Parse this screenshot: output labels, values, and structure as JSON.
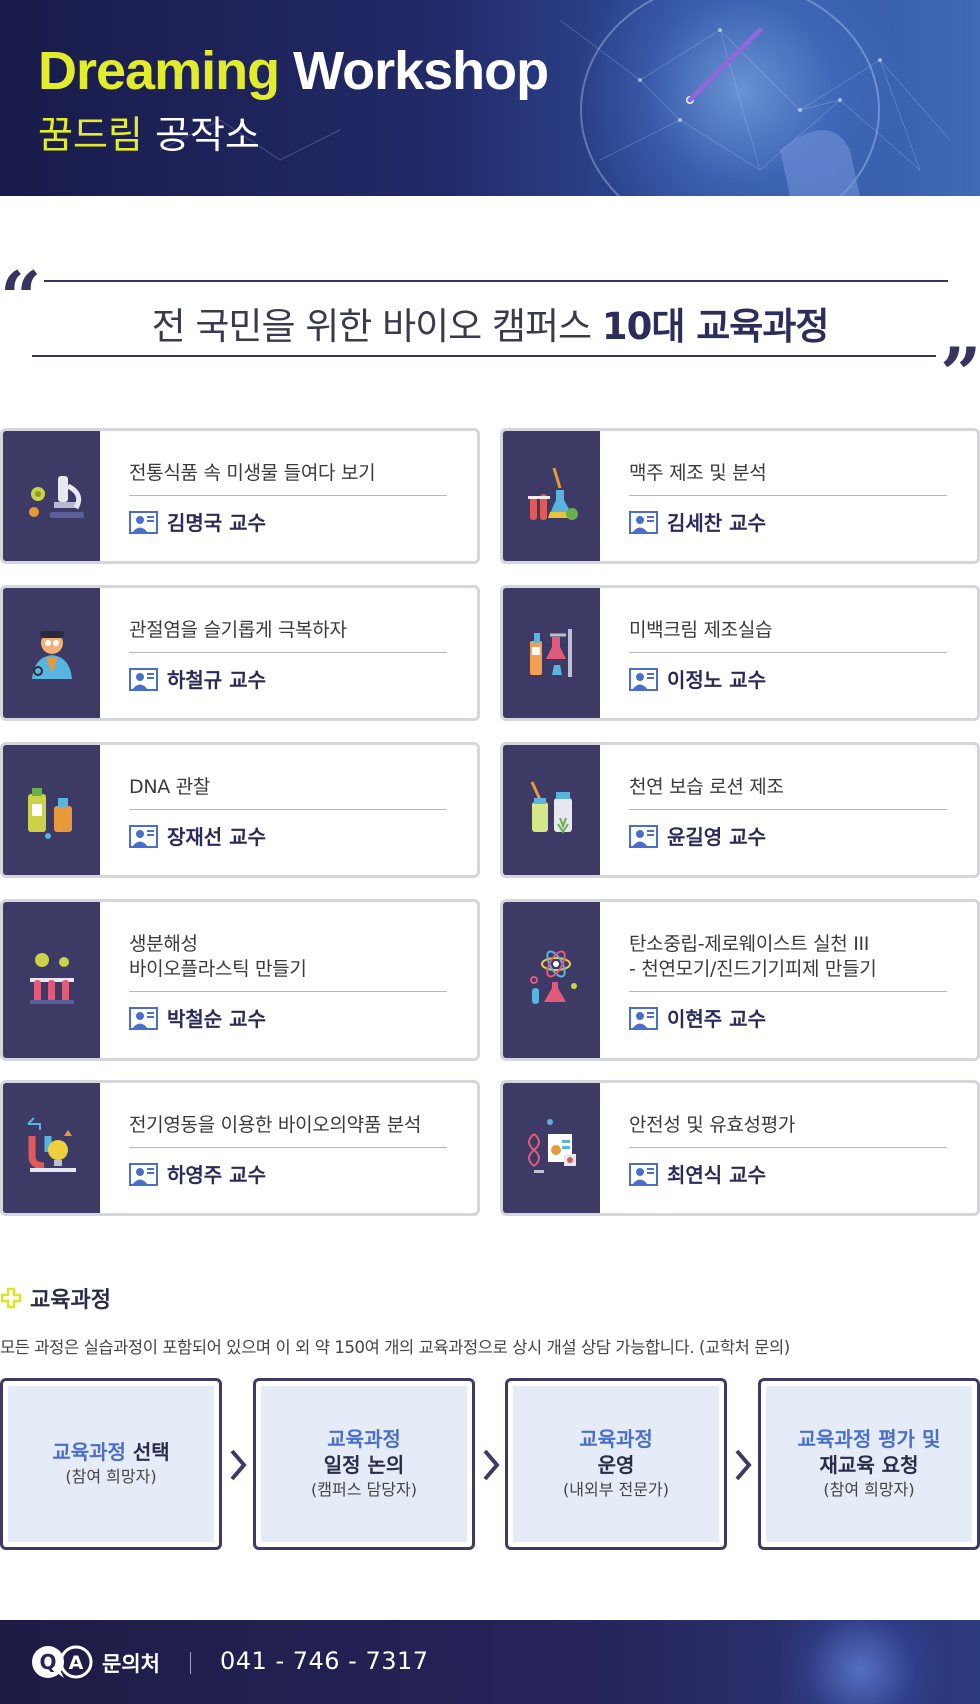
{
  "header": {
    "title_part1": "Dreaming",
    "title_part2": "Workshop",
    "subtitle_part1": "꿈드림",
    "subtitle_part2": "공작소"
  },
  "quote": {
    "text_normal": "전 국민을 위한 바이오 캠퍼스",
    "text_bold": "10대 교육과정"
  },
  "courses": [
    {
      "title": "전통식품 속 미생물 들여다 보기",
      "professor": "김명국 교수",
      "icon": "microscope-icon"
    },
    {
      "title": "맥주 제조 및 분석",
      "professor": "김세찬 교수",
      "icon": "lab-flasks-icon"
    },
    {
      "title": "관절염을 슬기롭게 극복하자",
      "professor": "하철규 교수",
      "icon": "doctor-icon"
    },
    {
      "title": "미백크림 제조실습",
      "professor": "이정노 교수",
      "icon": "lab-stand-icon"
    },
    {
      "title": "DNA 관찰",
      "professor": "장재선 교수",
      "icon": "bottles-icon"
    },
    {
      "title": "천연 보습 로션 제조",
      "professor": "윤길영 교수",
      "icon": "lotion-icon"
    },
    {
      "title": "생분해성\n바이오플라스틱 만들기",
      "professor": "박철순 교수",
      "icon": "test-tubes-icon"
    },
    {
      "title": "탄소중립-제로웨이스트 실천 III\n- 천연모기/진드기기피제 만들기",
      "professor": "이현주 교수",
      "icon": "atom-flask-icon"
    },
    {
      "title": "전기영동을 이용한 바이오의약품 분석",
      "professor": "하영주 교수",
      "icon": "magnet-bulb-icon"
    },
    {
      "title": "안전성 및 유효성평가",
      "professor": "최연식 교수",
      "icon": "dna-report-icon"
    }
  ],
  "curriculum": {
    "heading": "교육과정",
    "description": "모든 과정은 실습과정이 포함되어 있으며 이 외 약 150여 개의 교육과정으로 상시 개설 상담 가능합니다. (교학처 문의)",
    "steps": [
      {
        "line1": "",
        "line2_blue": "교육과정",
        "line2_dark": " 선택",
        "line3": "(참여 희망자)"
      },
      {
        "line1": "교육과정",
        "line2_blue": "",
        "line2_dark": "일정 논의",
        "line3": "(캠퍼스 담당자)"
      },
      {
        "line1": "교육과정",
        "line2_blue": "",
        "line2_dark": "운영",
        "line3": "(내외부 전문가)"
      },
      {
        "line1": "교육과정 평가 및",
        "line2_blue": "",
        "line2_dark": "재교육 요청",
        "line3": "(참여 희망자)"
      }
    ]
  },
  "footer": {
    "qa_letters": "QA",
    "label": "문의처",
    "phone": "041 - 746 - 7317"
  },
  "colors": {
    "accent_yellow": "#e2ec2a",
    "navy": "#3d3b66",
    "step_blue": "#4a6fc8",
    "step_bg": "#e6ebf8"
  }
}
